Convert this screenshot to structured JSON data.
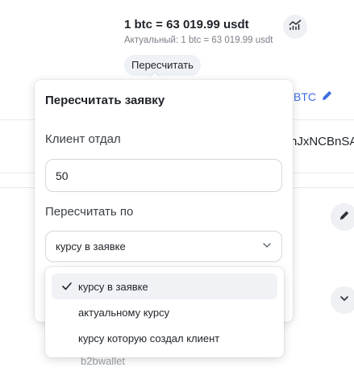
{
  "rate": {
    "main": "1 btc = 63 019.99 usdt",
    "actual": "Актуальный: 1 btc = 63 019.99 usdt",
    "recalc_button": "Пересчитать"
  },
  "background": {
    "currency_link": "BTC",
    "address_fragment": "nJxNCBnSA",
    "wallet_label": "b2bwallet"
  },
  "popover": {
    "title": "Пересчитать заявку",
    "client_gave_label": "Клиент отдал",
    "client_gave_value": "50",
    "recalc_by_label": "Пересчитать по",
    "selected_option": "курсу в заявке"
  },
  "dropdown": {
    "options": [
      {
        "label": "курсу в заявке",
        "selected": true
      },
      {
        "label": "актуальному курсу",
        "selected": false
      },
      {
        "label": "курсу которую создал клиент",
        "selected": false
      }
    ]
  },
  "icons": {
    "chart": "chart-trend-icon",
    "edit": "pencil-icon",
    "chevron": "chevron-down-icon",
    "check": "check-icon"
  },
  "colors": {
    "accent": "#3d6ee0",
    "selected_bg": "#f0f2f5"
  }
}
